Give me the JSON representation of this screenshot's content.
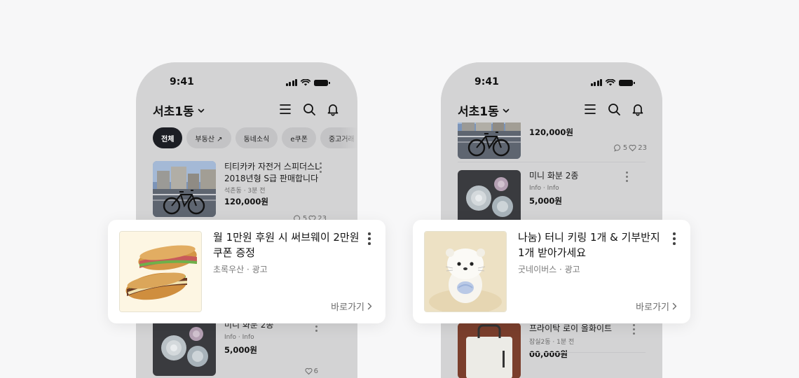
{
  "status_time": "9:41",
  "left_phone": {
    "location": "서초1동",
    "chips": [
      {
        "label": "전체"
      },
      {
        "label": "부동산 ↗"
      },
      {
        "label": "동네소식"
      },
      {
        "label": "e쿠폰"
      },
      {
        "label": "중고거래"
      }
    ],
    "listing_1": {
      "title": "티티카카 자전거 스피더스L 2018년형 S급 판매합니다",
      "meta": "석촌동 · 3분 전",
      "price": "120,000원",
      "comments": "5",
      "likes": "23"
    },
    "listing_2": {
      "title": "미니 화분 2종",
      "meta": "Info · Info",
      "price": "5,000원",
      "likes": "6"
    }
  },
  "right_phone": {
    "location": "서초1동",
    "listing_1": {
      "price": "120,000원",
      "comments": "5",
      "likes": "23"
    },
    "listing_2": {
      "title": "미니 화분 2종",
      "meta": "Info · Info",
      "price": "5,000원"
    },
    "listing_3": {
      "title": "프라이탁 로이 올화이트",
      "meta": "잠실2동 · 1분 전",
      "price": "00,000원"
    }
  },
  "ad_left": {
    "title": "월 1만원 후원 시 써브웨이 2만원 쿠폰 증정",
    "meta": "초록우산 · 광고",
    "cta": "바로가기"
  },
  "ad_right": {
    "title": "나눔) 터니 키링 1개 & 기부반지 1개 받아가세요",
    "meta": "굿네이버스 · 광고",
    "cta": "바로가기"
  },
  "icons": {
    "menu": "menu-icon",
    "search": "search-icon",
    "bell": "bell-icon",
    "chevron": "chevron-down-icon",
    "comment": "comment-icon",
    "heart": "heart-icon",
    "more": "more-vertical-icon",
    "arrow": "chevron-right-icon"
  },
  "colors": {
    "page_bg": "#f7f7f8",
    "phone_bg": "#d3d3d4",
    "chip_active": "#1c1e24",
    "chip": "#c3c3c5",
    "card_bg": "#ffffff"
  }
}
